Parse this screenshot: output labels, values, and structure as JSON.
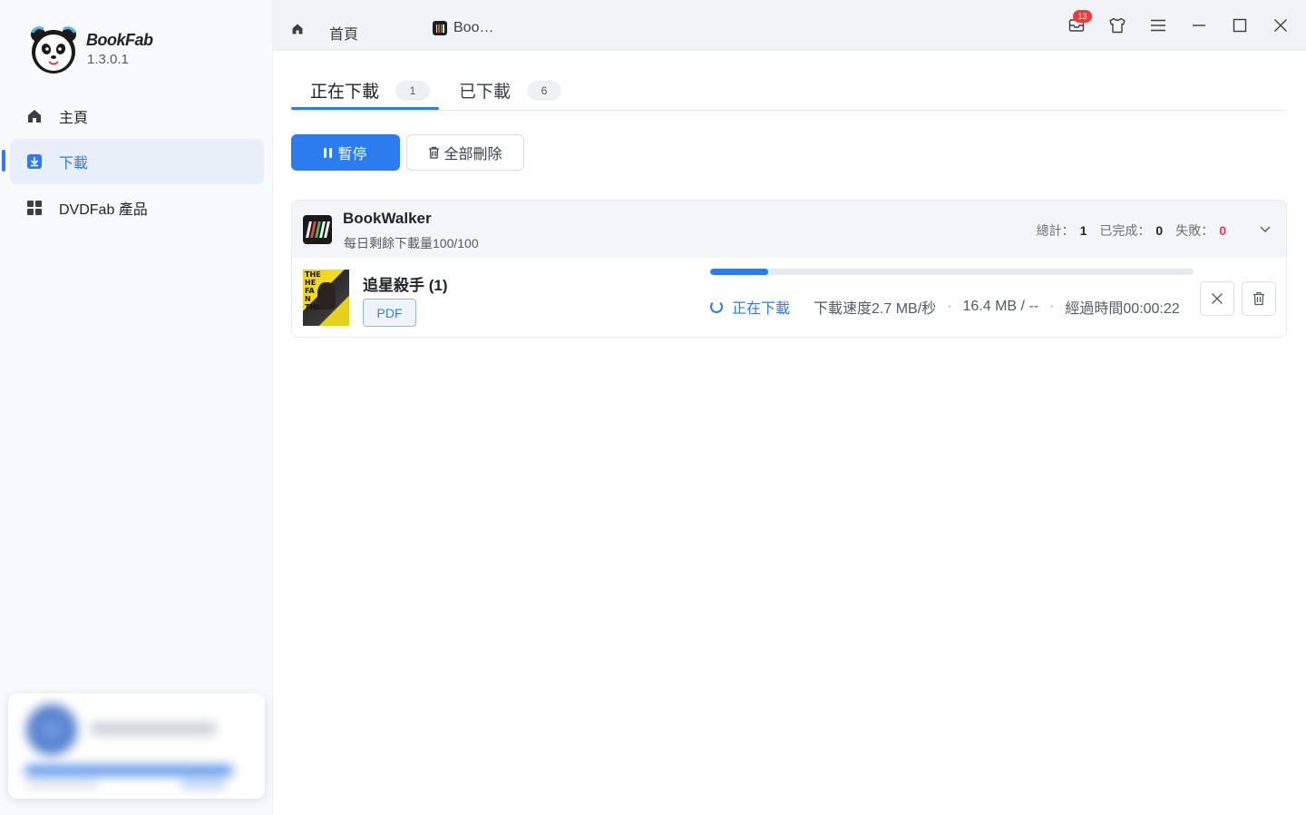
{
  "app": {
    "name": "BookFab",
    "version": "1.3.0.1"
  },
  "sidebar": {
    "items": [
      {
        "label": "主頁",
        "icon": "home-icon"
      },
      {
        "label": "下載",
        "icon": "download-icon",
        "active": true
      },
      {
        "label": "DVDFab 產品",
        "icon": "grid-icon"
      }
    ]
  },
  "topbar": {
    "tabs": [
      {
        "label": "首頁"
      },
      {
        "label": "Boo…"
      }
    ],
    "notification_count": "13"
  },
  "tabs": [
    {
      "label": "正在下載",
      "count": "1",
      "active": true
    },
    {
      "label": "已下載",
      "count": "6"
    }
  ],
  "actions": {
    "pause_label": "暫停",
    "delete_all_label": "全部刪除"
  },
  "group": {
    "title": "BookWalker",
    "subtitle": "每日剩餘下載量100/100",
    "stats": {
      "total_label": "總計：",
      "total": "1",
      "done_label": "已完成：",
      "done": "0",
      "failed_label": "失敗：",
      "failed": "0"
    },
    "items": [
      {
        "title": "追星殺手 (1)",
        "format": "PDF",
        "progress": 0.12,
        "status": "正在下載",
        "speed": "下載速度2.7 MB/秒",
        "size": "16.4 MB / --",
        "elapsed": "經過時間00:00:22"
      }
    ]
  },
  "colors": {
    "accent": "#2c7cf0",
    "badge": "#f23a3a",
    "fail": "#f23a52"
  }
}
